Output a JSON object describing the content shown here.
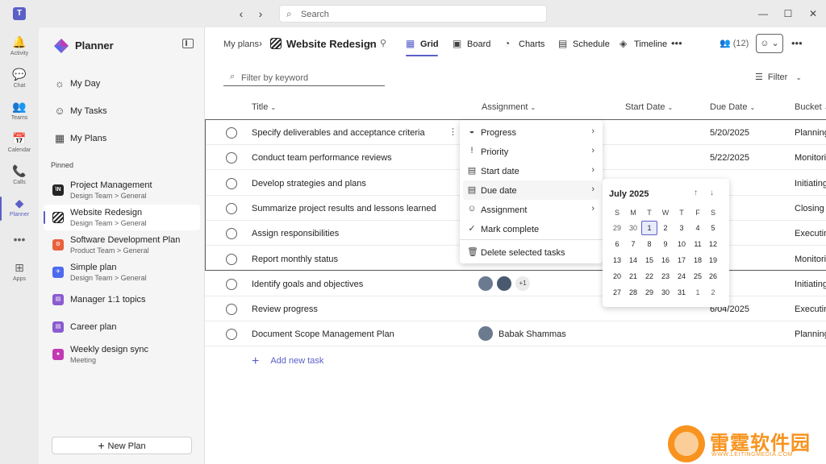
{
  "window": {
    "search_placeholder": "Search",
    "nav_back": "‹",
    "nav_forward": "›",
    "minimize": "—",
    "maximize": "☐",
    "close": "✕"
  },
  "rail": [
    {
      "label": "Activity",
      "icon": "bell-icon",
      "glyph": "🔔"
    },
    {
      "label": "Chat",
      "icon": "chat-icon",
      "glyph": "💬"
    },
    {
      "label": "Teams",
      "icon": "teams-icon",
      "glyph": "👥"
    },
    {
      "label": "Calendar",
      "icon": "calendar-icon",
      "glyph": "📅"
    },
    {
      "label": "Calls",
      "icon": "phone-icon",
      "glyph": "📞"
    },
    {
      "label": "Planner",
      "icon": "planner-icon",
      "glyph": "◆",
      "active": true
    },
    {
      "label": "",
      "icon": "more-icon",
      "glyph": "•••"
    },
    {
      "label": "Apps",
      "icon": "apps-icon",
      "glyph": "⊞"
    }
  ],
  "sidebar": {
    "title": "Planner",
    "nav": [
      {
        "label": "My Day",
        "icon": "sun-icon",
        "glyph": "☼"
      },
      {
        "label": "My Tasks",
        "icon": "person-task-icon",
        "glyph": "☺"
      },
      {
        "label": "My Plans",
        "icon": "grid-plans-icon",
        "glyph": "▦"
      }
    ],
    "pinned_label": "Pinned",
    "pinned": [
      {
        "name": "Project Management",
        "sub": "Design Team > General",
        "icon_text": "\\N",
        "color": "#242424"
      },
      {
        "name": "Website Redesign",
        "sub": "Design Team > General",
        "icon_text": "",
        "color": "#242424",
        "active": true
      },
      {
        "name": "Software Development Plan",
        "sub": "Product Team > General",
        "icon_text": "⚙",
        "color": "#e8613c"
      },
      {
        "name": "Simple plan",
        "sub": "Design Team > General",
        "icon_text": "✈",
        "color": "#4f6bed"
      },
      {
        "name": "Manager 1:1 topics",
        "sub": "",
        "icon_text": "▤",
        "color": "#8a5ccf"
      },
      {
        "name": "Career plan",
        "sub": "",
        "icon_text": "▤",
        "color": "#8a5ccf"
      },
      {
        "name": "Weekly design sync",
        "sub": "Meeting",
        "icon_text": "●",
        "color": "#c239b3"
      }
    ],
    "new_plan_label": "New Plan"
  },
  "main": {
    "breadcrumb_root": "My plans",
    "plan_title": "Website Redesign",
    "tabs": [
      {
        "label": "Grid",
        "glyph": "▦",
        "active": true
      },
      {
        "label": "Board",
        "glyph": "▣"
      },
      {
        "label": "Charts",
        "glyph": "◔"
      },
      {
        "label": "Schedule",
        "glyph": "▤"
      },
      {
        "label": "Timeline",
        "glyph": "◈"
      }
    ],
    "members_count": "(12)",
    "filter_placeholder": "Filter by keyword",
    "filter_label": "Filter",
    "columns": {
      "title": "Title",
      "assignment": "Assignment",
      "start_date": "Start Date",
      "due_date": "Due Date",
      "bucket": "Bucket"
    },
    "tasks": [
      {
        "title": "Specify deliverables and acceptance criteria",
        "due": "5/20/2025",
        "bucket": "Planning"
      },
      {
        "title": "Conduct team performance reviews",
        "due": "5/22/2025",
        "bucket": "Monitoring"
      },
      {
        "title": "Develop strategies and plans",
        "due": "",
        "bucket": "Initiating"
      },
      {
        "title": "Summarize project results and lessons learned",
        "due": "",
        "bucket": "Closing"
      },
      {
        "title": "Assign responsibilities",
        "due": "",
        "bucket": "Executing"
      },
      {
        "title": "Report monthly status",
        "due": "",
        "bucket": "Monitoring"
      },
      {
        "title": "Identify goals and objectives",
        "due": "",
        "bucket": "Initiating",
        "assignees_extra": "+1"
      },
      {
        "title": "Review progress",
        "due": "6/04/2025",
        "bucket": "Executing"
      },
      {
        "title": "Document Scope Management Plan",
        "due": "",
        "bucket": "Planning",
        "assignee": "Babak Shammas"
      }
    ],
    "add_task_label": "Add new task"
  },
  "context_menu": {
    "items": [
      {
        "label": "Progress",
        "glyph": "◒",
        "icon": "progress-icon",
        "submenu": true
      },
      {
        "label": "Priority",
        "glyph": "!",
        "icon": "priority-icon",
        "submenu": true
      },
      {
        "label": "Start date",
        "glyph": "▤",
        "icon": "calendar-start-icon",
        "submenu": true
      },
      {
        "label": "Due date",
        "glyph": "▤",
        "icon": "calendar-due-icon",
        "submenu": true,
        "hover": true
      },
      {
        "label": "Assignment",
        "glyph": "☺",
        "icon": "assign-icon",
        "submenu": true
      },
      {
        "label": "Mark complete",
        "glyph": "✓",
        "icon": "check-circle-icon"
      },
      {
        "label": "Delete selected tasks",
        "glyph": "🗑",
        "icon": "trash-icon"
      }
    ]
  },
  "calendar": {
    "month_label": "July 2025",
    "dow": [
      "S",
      "M",
      "T",
      "W",
      "T",
      "F",
      "S"
    ],
    "weeks": [
      [
        "29",
        "30",
        "1",
        "2",
        "3",
        "4",
        "5"
      ],
      [
        "6",
        "7",
        "8",
        "9",
        "10",
        "11",
        "12"
      ],
      [
        "13",
        "14",
        "15",
        "16",
        "17",
        "18",
        "19"
      ],
      [
        "20",
        "21",
        "22",
        "23",
        "24",
        "25",
        "26"
      ],
      [
        "27",
        "28",
        "29",
        "30",
        "31",
        "1",
        "2"
      ]
    ],
    "today": "1"
  },
  "watermark": {
    "text": "雷霆软件园",
    "url": "WWW.LEITINGMEDIA.COM",
    "color": "#f7931e"
  }
}
